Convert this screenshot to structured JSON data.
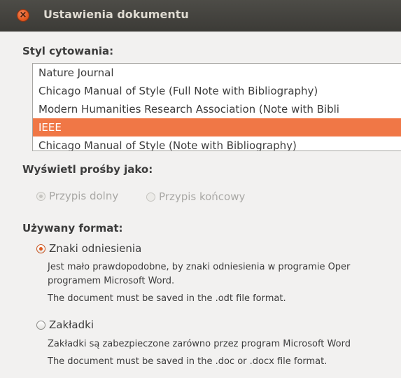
{
  "window": {
    "title": "Ustawienia dokumentu"
  },
  "citation_style": {
    "heading": "Styl cytowania:",
    "items": [
      {
        "label": "Nature Journal",
        "selected": false
      },
      {
        "label": "Chicago Manual of Style (Full Note with Bibliography)",
        "selected": false
      },
      {
        "label": "Modern Humanities Research Association (Note with Bibli",
        "selected": false
      },
      {
        "label": "IEEE",
        "selected": true
      },
      {
        "label": "Chicago Manual of Style (Note with Bibliography)",
        "selected": false
      }
    ]
  },
  "notes_display": {
    "heading": "Wyświetl prośby jako:",
    "options": [
      {
        "label": "Przypis dolny",
        "checked": true,
        "enabled": false
      },
      {
        "label": "Przypis końcowy",
        "checked": false,
        "enabled": false
      }
    ]
  },
  "format": {
    "heading": "Używany format:",
    "options": [
      {
        "label": "Znaki odniesienia",
        "checked": true,
        "desc_line1": "Jest mało prawdopodobne, by znaki odniesienia w programie Oper",
        "desc_line2": "programem Microsoft Word.",
        "desc_line3": "The document must be saved in the .odt file format."
      },
      {
        "label": "Zakładki",
        "checked": false,
        "desc_line1": "Zakładki są zabezpieczone zarówno przez program Microsoft Word",
        "desc_line2": "The document must be saved in the .doc or .docx file format."
      }
    ]
  },
  "colors": {
    "accent": "#f07746",
    "titlebar": "#3c3b37"
  }
}
